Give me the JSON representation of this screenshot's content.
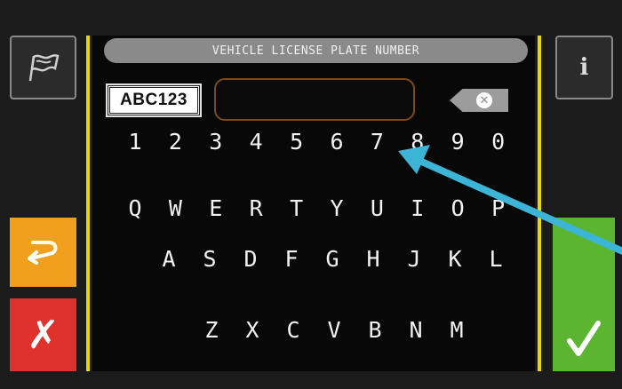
{
  "header": {
    "title": "VEHICLE LICENSE PLATE NUMBER"
  },
  "plate_example": "ABC123",
  "input": {
    "value": ""
  },
  "info_label": "i",
  "cancel_label": "✗",
  "keyboard": {
    "rows": [
      [
        "1",
        "2",
        "3",
        "4",
        "5",
        "6",
        "7",
        "8",
        "9",
        "0"
      ],
      [
        "Q",
        "W",
        "E",
        "R",
        "T",
        "Y",
        "U",
        "I",
        "O",
        "P"
      ],
      [
        "A",
        "S",
        "D",
        "F",
        "G",
        "H",
        "J",
        "K",
        "L"
      ],
      [
        "Z",
        "X",
        "C",
        "V",
        "B",
        "N",
        "M"
      ]
    ]
  },
  "colors": {
    "back": "#f0a01c",
    "cancel": "#e0322c",
    "confirm": "#5cb531",
    "rail": "#e8d800",
    "arrow": "#3cb4d6"
  },
  "icons": {
    "language": "flag-icon",
    "info": "info-icon",
    "back": "return-arrow-icon",
    "cancel": "cross-icon",
    "confirm": "checkmark-icon",
    "delete": "backspace-icon"
  }
}
